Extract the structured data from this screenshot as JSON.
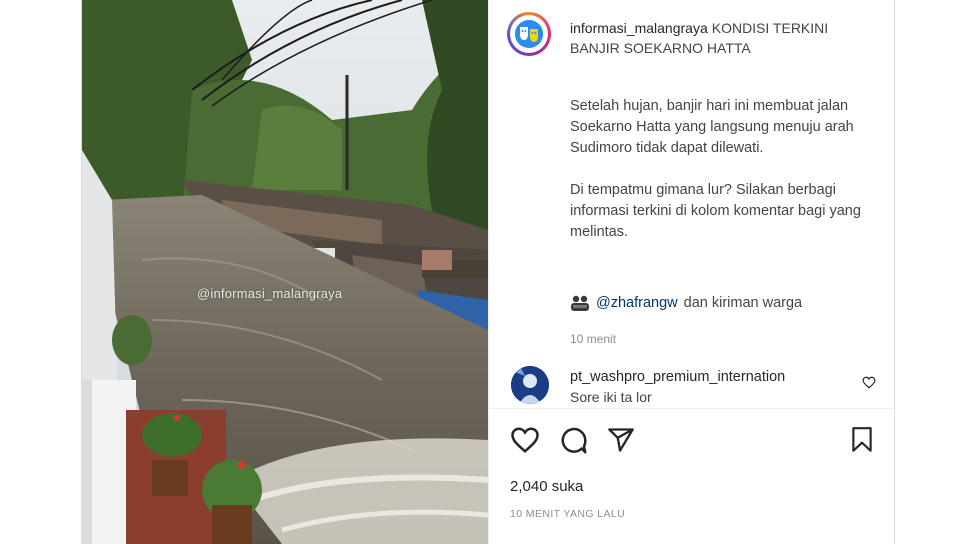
{
  "post": {
    "username": "informasi_malangraya",
    "caption_title": "KONDISI TERKINI BANJIR SOEKARNO HATTA",
    "paragraph1": "Setelah hujan, banjir hari ini membuat jalan Soekarno Hatta yang langsung menuju arah Sudimoro tidak dapat dilewati.",
    "paragraph2": "Di tempatmu gimana lur? Silakan berbagi informasi terkini di kolom komentar bagi yang melintas.",
    "credit_mention": "@zhafrangw",
    "credit_rest": "dan kiriman warga",
    "caption_time": "10 menit",
    "watermark": "@informasi_malangraya"
  },
  "comment": {
    "username": "pt_washpro_premium_internation",
    "text": "Sore iki ta lor"
  },
  "footer": {
    "likes": "2,040 suka",
    "time_ago": "10 MENIT YANG LALU"
  },
  "icons": {
    "like": "heart-icon",
    "comment": "comment-icon",
    "share": "share-icon",
    "save": "bookmark-icon",
    "comment_like": "heart-icon",
    "credit": "people-icon"
  },
  "colors": {
    "text": "#262626",
    "secondary": "#8e8e8e",
    "link": "#00376b"
  }
}
